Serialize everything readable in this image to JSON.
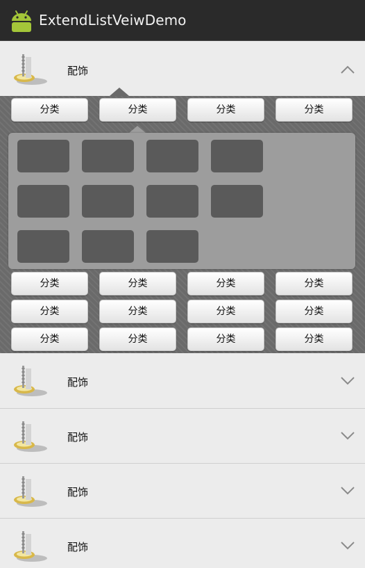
{
  "app": {
    "title": "ExtendListVeiwDemo"
  },
  "list": {
    "rows": [
      {
        "label": "配饰",
        "expanded": true
      },
      {
        "label": "配饰",
        "expanded": false
      },
      {
        "label": "配饰",
        "expanded": false
      },
      {
        "label": "配饰",
        "expanded": false
      },
      {
        "label": "配饰",
        "expanded": false
      }
    ]
  },
  "expanded": {
    "top_buttons": [
      "分类",
      "分类",
      "分类",
      "分类"
    ],
    "bottom_buttons": [
      [
        "分类",
        "分类",
        "分类",
        "分类"
      ],
      [
        "分类",
        "分类",
        "分类",
        "分类"
      ],
      [
        "分类",
        "分类",
        "分类",
        "分类"
      ]
    ],
    "tile_rows": [
      4,
      4,
      3
    ]
  },
  "icons": {
    "app_logo": "android-icon",
    "row_icon": "jewelry-icon",
    "collapse": "chevron-up-icon",
    "expand": "chevron-down-icon"
  },
  "colors": {
    "action_bar": "#2a2a2a",
    "android_green": "#a4c639",
    "row_bg": "#ececec",
    "panel_bg": "#9d9d9d",
    "tile": "#5a5a5a"
  }
}
